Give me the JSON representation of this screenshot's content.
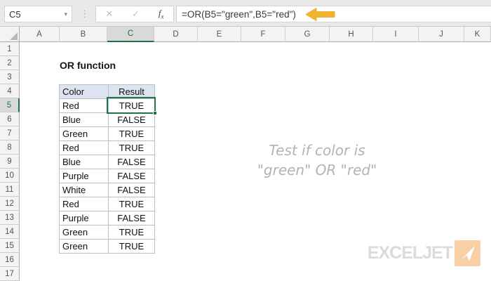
{
  "formula_bar": {
    "name_box": "C5",
    "caret_icon": "▾",
    "separator_dots": "⋮",
    "cancel_icon": "✕",
    "enter_icon": "✓",
    "fx_f": "f",
    "fx_x": "x",
    "formula": "=OR(B5=\"green\",B5=\"red\")"
  },
  "grid": {
    "columns": [
      "A",
      "B",
      "C",
      "D",
      "E",
      "F",
      "G",
      "H",
      "I",
      "J",
      "K"
    ],
    "rows": [
      "1",
      "2",
      "3",
      "4",
      "5",
      "6",
      "7",
      "8",
      "9",
      "10",
      "11",
      "12",
      "13",
      "14",
      "15",
      "16",
      "17"
    ],
    "selected_column": "C",
    "selected_row": "5"
  },
  "content": {
    "title": "OR function",
    "table": {
      "headers": [
        "Color",
        "Result"
      ],
      "rows": [
        [
          "Red",
          "TRUE"
        ],
        [
          "Blue",
          "FALSE"
        ],
        [
          "Green",
          "TRUE"
        ],
        [
          "Red",
          "TRUE"
        ],
        [
          "Blue",
          "FALSE"
        ],
        [
          "Purple",
          "FALSE"
        ],
        [
          "White",
          "FALSE"
        ],
        [
          "Red",
          "TRUE"
        ],
        [
          "Purple",
          "FALSE"
        ],
        [
          "Green",
          "TRUE"
        ],
        [
          "Green",
          "TRUE"
        ]
      ]
    },
    "annotation": {
      "line1": "Test if color is",
      "line2": "\"green\" OR \"red\""
    }
  },
  "logo": {
    "text": "EXCELJET"
  },
  "colors": {
    "accent_green": "#217346",
    "arrow_yellow": "#efb32f",
    "table_header_bg": "#dde3f1",
    "logo_orange": "#f9d0a6",
    "annotation_gray": "#b3b3b3"
  }
}
